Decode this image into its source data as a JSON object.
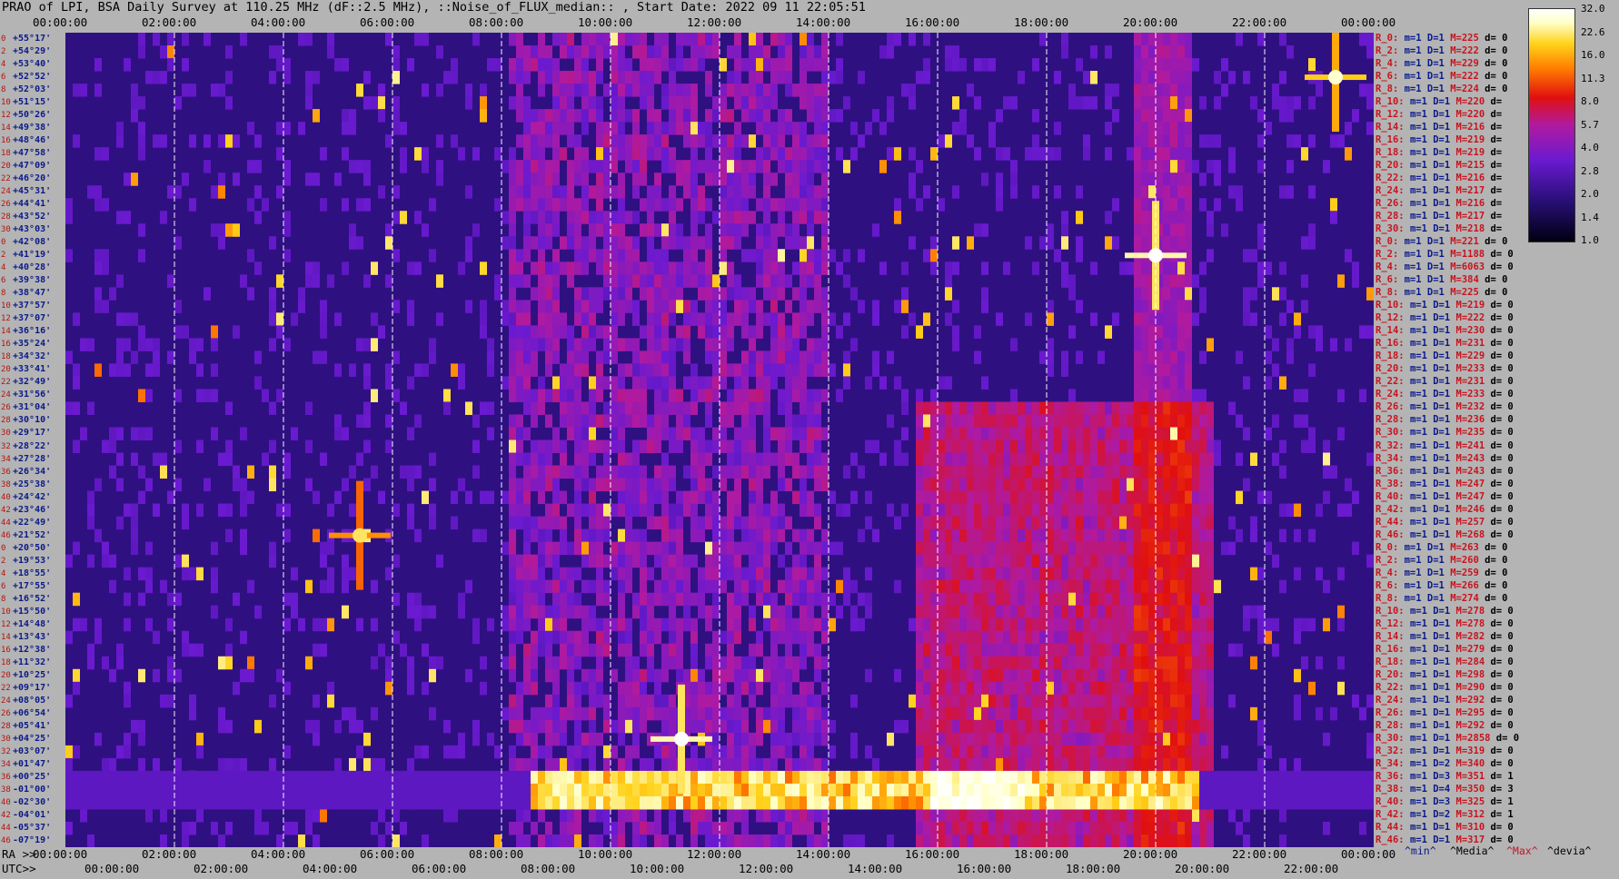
{
  "title": "PRAO of LPI, BSA Daily Survey at 110.25 MHz (dF::2.5 MHz), ::Noise_of_FLUX_median:: , Start Date: 2022 09 11 22:05:51",
  "x_top_ticks": [
    "00:00:00",
    "02:00:00",
    "04:00:00",
    "06:00:00",
    "08:00:00",
    "10:00:00",
    "12:00:00",
    "14:00:00",
    "16:00:00",
    "18:00:00",
    "20:00:00",
    "22:00:00",
    "00:00:00"
  ],
  "x_bottom_ra_label": "RA >>",
  "x_bottom_ra_ticks": [
    "00:00:00",
    "02:00:00",
    "04:00:00",
    "06:00:00",
    "08:00:00",
    "10:00:00",
    "12:00:00",
    "14:00:00",
    "16:00:00",
    "18:00:00",
    "20:00:00",
    "22:00:00",
    "00:00:00"
  ],
  "x_bottom_utc_label": "UTC>>",
  "x_bottom_utc_ticks": [
    "00:00:00",
    "02:00:00",
    "04:00:00",
    "06:00:00",
    "08:00:00",
    "10:00:00",
    "12:00:00",
    "14:00:00",
    "16:00:00",
    "18:00:00",
    "20:00:00",
    "22:00:00"
  ],
  "dec_labels": [
    "+55°17'",
    "+54°29'",
    "+53°40'",
    "+52°52'",
    "+52°03'",
    "+51°15'",
    "+50°26'",
    "+49°38'",
    "+48°46'",
    "+47°58'",
    "+47°09'",
    "+46°20'",
    "+45°31'",
    "+44°41'",
    "+43°52'",
    "+43°03'",
    "+42°08'",
    "+41°19'",
    "+40°28'",
    "+39°38'",
    "+38°47'",
    "+37°57'",
    "+37°07'",
    "+36°16'",
    "+35°24'",
    "+34°32'",
    "+33°41'",
    "+32°49'",
    "+31°56'",
    "+31°04'",
    "+30°10'",
    "+29°17'",
    "+28°22'",
    "+27°28'",
    "+26°34'",
    "+25°38'",
    "+24°42'",
    "+23°46'",
    "+22°49'",
    "+21°52'",
    "+20°50'",
    "+19°53'",
    "+18°55'",
    "+17°55'",
    "+16°52'",
    "+15°50'",
    "+14°48'",
    "+13°43'",
    "+12°38'",
    "+11°32'",
    "+10°25'",
    "+09°17'",
    "+08°05'",
    "+06°54'",
    "+05°41'",
    "+04°25'",
    "+03°07'",
    "+01°47'",
    "+00°25'",
    "-01°00'",
    "-02°30'",
    "-04°01'",
    "-05°37'",
    "-07°19'"
  ],
  "row_index_labels": [
    "0",
    "2",
    "4",
    "6",
    "8",
    "10",
    "12",
    "14",
    "16",
    "18",
    "20",
    "22",
    "24",
    "26",
    "28",
    "30",
    "0",
    "2",
    "4",
    "6",
    "8",
    "10",
    "12",
    "14",
    "16",
    "18",
    "20",
    "22",
    "24",
    "26",
    "28",
    "30",
    "32",
    "34",
    "36",
    "38",
    "40",
    "42",
    "44",
    "46",
    "0",
    "2",
    "4",
    "6",
    "8",
    "10",
    "12",
    "14",
    "16",
    "18",
    "20",
    "22",
    "24",
    "26",
    "28",
    "30",
    "32",
    "34",
    "36",
    "38",
    "40",
    "42",
    "44",
    "46"
  ],
  "stats_rows": [
    [
      "R_0:",
      "m=1",
      "D=1",
      "M=225",
      "d= 0"
    ],
    [
      "R_2:",
      "m=1",
      "D=1",
      "M=222",
      "d= 0"
    ],
    [
      "R_4:",
      "m=1",
      "D=1",
      "M=229",
      "d= 0"
    ],
    [
      "R_6:",
      "m=1",
      "D=1",
      "M=222",
      "d= 0"
    ],
    [
      "R_8:",
      "m=1",
      "D=1",
      "M=224",
      "d= 0"
    ],
    [
      "R_10:",
      "m=1",
      "D=1",
      "M=220",
      "d="
    ],
    [
      "R_12:",
      "m=1",
      "D=1",
      "M=220",
      "d="
    ],
    [
      "R_14:",
      "m=1",
      "D=1",
      "M=216",
      "d="
    ],
    [
      "R_16:",
      "m=1",
      "D=1",
      "M=219",
      "d="
    ],
    [
      "R_18:",
      "m=1",
      "D=1",
      "M=219",
      "d="
    ],
    [
      "R_20:",
      "m=1",
      "D=1",
      "M=215",
      "d="
    ],
    [
      "R_22:",
      "m=1",
      "D=1",
      "M=216",
      "d="
    ],
    [
      "R_24:",
      "m=1",
      "D=1",
      "M=217",
      "d="
    ],
    [
      "R_26:",
      "m=1",
      "D=1",
      "M=216",
      "d="
    ],
    [
      "R_28:",
      "m=1",
      "D=1",
      "M=217",
      "d="
    ],
    [
      "R_30:",
      "m=1",
      "D=1",
      "M=218",
      "d="
    ],
    [
      "R_0:",
      "m=1",
      "D=1",
      "M=221",
      "d= 0"
    ],
    [
      "R_2:",
      "m=1",
      "D=1",
      "M=1188",
      "d= 0"
    ],
    [
      "R_4:",
      "m=1",
      "D=1",
      "M=6063",
      "d= 0"
    ],
    [
      "R_6:",
      "m=1",
      "D=1",
      "M=384",
      "d= 0"
    ],
    [
      "R_8:",
      "m=1",
      "D=1",
      "M=225",
      "d= 0"
    ],
    [
      "R_10:",
      "m=1",
      "D=1",
      "M=219",
      "d= 0"
    ],
    [
      "R_12:",
      "m=1",
      "D=1",
      "M=222",
      "d= 0"
    ],
    [
      "R_14:",
      "m=1",
      "D=1",
      "M=230",
      "d= 0"
    ],
    [
      "R_16:",
      "m=1",
      "D=1",
      "M=231",
      "d= 0"
    ],
    [
      "R_18:",
      "m=1",
      "D=1",
      "M=229",
      "d= 0"
    ],
    [
      "R_20:",
      "m=1",
      "D=1",
      "M=233",
      "d= 0"
    ],
    [
      "R_22:",
      "m=1",
      "D=1",
      "M=231",
      "d= 0"
    ],
    [
      "R_24:",
      "m=1",
      "D=1",
      "M=233",
      "d= 0"
    ],
    [
      "R_26:",
      "m=1",
      "D=1",
      "M=232",
      "d= 0"
    ],
    [
      "R_28:",
      "m=1",
      "D=1",
      "M=236",
      "d= 0"
    ],
    [
      "R_30:",
      "m=1",
      "D=1",
      "M=235",
      "d= 0"
    ],
    [
      "R_32:",
      "m=1",
      "D=1",
      "M=241",
      "d= 0"
    ],
    [
      "R_34:",
      "m=1",
      "D=1",
      "M=243",
      "d= 0"
    ],
    [
      "R_36:",
      "m=1",
      "D=1",
      "M=243",
      "d= 0"
    ],
    [
      "R_38:",
      "m=1",
      "D=1",
      "M=247",
      "d= 0"
    ],
    [
      "R_40:",
      "m=1",
      "D=1",
      "M=247",
      "d= 0"
    ],
    [
      "R_42:",
      "m=1",
      "D=1",
      "M=246",
      "d= 0"
    ],
    [
      "R_44:",
      "m=1",
      "D=1",
      "M=257",
      "d= 0"
    ],
    [
      "R_46:",
      "m=1",
      "D=1",
      "M=268",
      "d= 0"
    ],
    [
      "R_0:",
      "m=1",
      "D=1",
      "M=263",
      "d= 0"
    ],
    [
      "R_2:",
      "m=1",
      "D=1",
      "M=260",
      "d= 0"
    ],
    [
      "R_4:",
      "m=1",
      "D=1",
      "M=259",
      "d= 0"
    ],
    [
      "R_6:",
      "m=1",
      "D=1",
      "M=266",
      "d= 0"
    ],
    [
      "R_8:",
      "m=1",
      "D=1",
      "M=274",
      "d= 0"
    ],
    [
      "R_10:",
      "m=1",
      "D=1",
      "M=278",
      "d= 0"
    ],
    [
      "R_12:",
      "m=1",
      "D=1",
      "M=278",
      "d= 0"
    ],
    [
      "R_14:",
      "m=1",
      "D=1",
      "M=282",
      "d= 0"
    ],
    [
      "R_16:",
      "m=1",
      "D=1",
      "M=279",
      "d= 0"
    ],
    [
      "R_18:",
      "m=1",
      "D=1",
      "M=284",
      "d= 0"
    ],
    [
      "R_20:",
      "m=1",
      "D=1",
      "M=298",
      "d= 0"
    ],
    [
      "R_22:",
      "m=1",
      "D=1",
      "M=290",
      "d= 0"
    ],
    [
      "R_24:",
      "m=1",
      "D=1",
      "M=292",
      "d= 0"
    ],
    [
      "R_26:",
      "m=1",
      "D=1",
      "M=295",
      "d= 0"
    ],
    [
      "R_28:",
      "m=1",
      "D=1",
      "M=292",
      "d= 0"
    ],
    [
      "R_30:",
      "m=1",
      "D=1",
      "M=2858",
      "d= 0"
    ],
    [
      "R_32:",
      "m=1",
      "D=1",
      "M=319",
      "d= 0"
    ],
    [
      "R_34:",
      "m=1",
      "D=2",
      "M=340",
      "d= 0"
    ],
    [
      "R_36:",
      "m=1",
      "D=3",
      "M=351",
      "d= 1"
    ],
    [
      "R_38:",
      "m=1",
      "D=4",
      "M=350",
      "d= 3"
    ],
    [
      "R_40:",
      "m=1",
      "D=3",
      "M=325",
      "d= 1"
    ],
    [
      "R_42:",
      "m=1",
      "D=2",
      "M=312",
      "d= 1"
    ],
    [
      "R_44:",
      "m=1",
      "D=1",
      "M=310",
      "d= 0"
    ],
    [
      "R_46:",
      "m=1",
      "D=1",
      "M=317",
      "d= 0"
    ]
  ],
  "legend": {
    "min": "^min^",
    "median": "^Media^",
    "max": "^Max^",
    "devia": "^devia^"
  },
  "colorbar": {
    "ticks": [
      "32.0",
      "22.6",
      "16.0",
      "11.3",
      "8.0",
      "5.7",
      "4.0",
      "2.8",
      "2.0",
      "1.4",
      "1.0"
    ],
    "colors": [
      "#000010",
      "#2a0f7a",
      "#6a1ad0",
      "#b01aa0",
      "#e01010",
      "#ff7a00",
      "#ffd21a",
      "#ffffc8",
      "#ffffff"
    ]
  },
  "chart_data": {
    "type": "heatmap",
    "title": "PRAO of LPI, BSA Daily Survey at 110.25 MHz (dF::2.5 MHz), ::Noise_of_FLUX_median:: , Start Date: 2022 09 11 22:05:51",
    "x_range_hours": [
      0,
      24
    ],
    "x_ticks": [
      "00:00:00",
      "02:00:00",
      "04:00:00",
      "06:00:00",
      "08:00:00",
      "10:00:00",
      "12:00:00",
      "14:00:00",
      "16:00:00",
      "18:00:00",
      "20:00:00",
      "22:00:00",
      "00:00:00"
    ],
    "y_rows": 64,
    "scale": "log2",
    "value_range": [
      1.0,
      32.0
    ],
    "bright_sources": [
      {
        "ra_h": 20.0,
        "dec_row": 17,
        "intensity": 32
      },
      {
        "ra_h": 11.3,
        "dec_row": 55,
        "intensity": 32
      },
      {
        "ra_h": 23.3,
        "dec_row": 3,
        "intensity": 22
      },
      {
        "ra_h": 5.4,
        "dec_row": 39,
        "intensity": 16
      }
    ],
    "band_rows": [
      58,
      59,
      60
    ],
    "grid": true
  }
}
